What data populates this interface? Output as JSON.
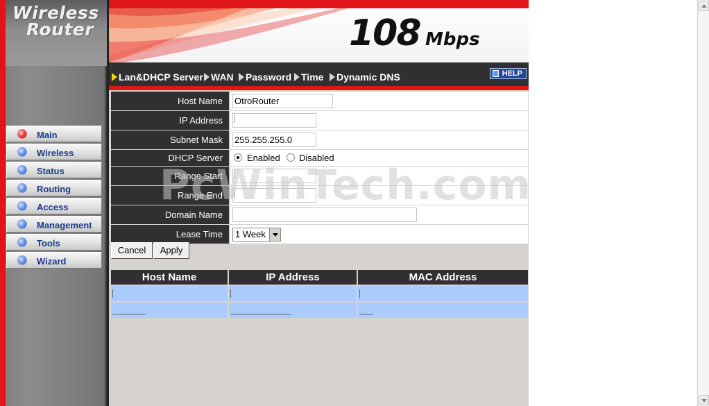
{
  "logo": {
    "line1": "Wireless",
    "line2": "Router"
  },
  "banner": {
    "speed": "108",
    "unit": "Mbps"
  },
  "tabs": [
    {
      "label": "Lan&DHCP Server"
    },
    {
      "label": "WAN"
    },
    {
      "label": "Password"
    },
    {
      "label": "Time"
    },
    {
      "label": "Dynamic DNS"
    }
  ],
  "help": {
    "label": "HELP"
  },
  "nav": [
    {
      "label": "Main",
      "active": true
    },
    {
      "label": "Wireless"
    },
    {
      "label": "Status"
    },
    {
      "label": "Routing"
    },
    {
      "label": "Access"
    },
    {
      "label": "Management"
    },
    {
      "label": "Tools"
    },
    {
      "label": "Wizard"
    }
  ],
  "form": {
    "host_name": {
      "label": "Host Name",
      "value": "OtroRouter"
    },
    "ip_address": {
      "label": "IP Address",
      "value": ""
    },
    "subnet_mask": {
      "label": "Subnet Mask",
      "value": "255.255.255.0"
    },
    "dhcp_server": {
      "label": "DHCP Server",
      "enabled_label": "Enabled",
      "disabled_label": "Disabled",
      "selected": "Enabled"
    },
    "range_start": {
      "label": "Range Start",
      "value": ""
    },
    "range_end": {
      "label": "Range End",
      "value": ""
    },
    "domain_name": {
      "label": "Domain Name",
      "value": ""
    },
    "lease_time": {
      "label": "Lease Time",
      "value": "1 Week"
    }
  },
  "buttons": {
    "cancel": "Cancel",
    "apply": "Apply"
  },
  "clients": {
    "columns": [
      "Host Name",
      "IP Address",
      "MAC Address"
    ],
    "rows": [
      [
        "",
        "",
        ""
      ],
      [
        "",
        "",
        ""
      ]
    ]
  },
  "watermark": "PcWinTech.com",
  "colors": {
    "accent_red": "#e0151a",
    "header_dark": "#303030",
    "row_blue": "#aaccff",
    "nav_text": "#1a3a8a"
  }
}
